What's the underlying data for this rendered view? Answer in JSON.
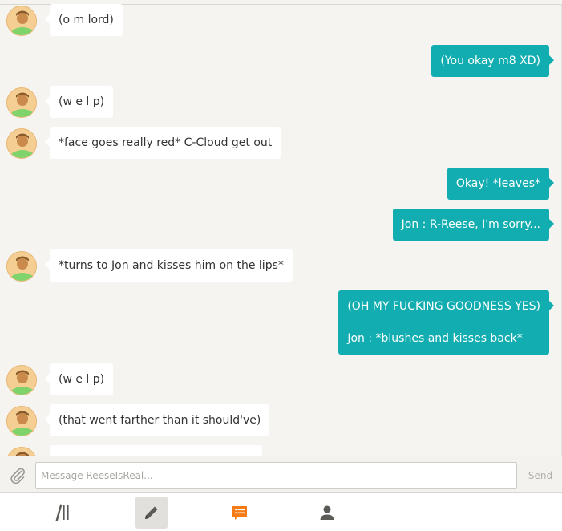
{
  "colors": {
    "outgoing": "#11adb0",
    "incoming": "#ffffff",
    "background": "#f5f4f1",
    "chat_tab": "#f47b16"
  },
  "messages": [
    {
      "side": "in",
      "text": "(o m lord)"
    },
    {
      "side": "out",
      "text": "(You okay m8 XD)"
    },
    {
      "side": "in",
      "text": "(w e l p)"
    },
    {
      "side": "in",
      "text": "*face goes really red* C-Cloud get out"
    },
    {
      "side": "out",
      "text": "Okay! *leaves*"
    },
    {
      "side": "out",
      "text": "Jon : R-Reese, I'm sorry..."
    },
    {
      "side": "in",
      "text": "*turns to Jon and kisses him on the lips*"
    },
    {
      "side": "out",
      "line1": "(OH MY FUCKING GOODNESS YES)",
      "line2": "Jon : *blushes and kisses back*"
    },
    {
      "side": "in",
      "text": "(w e l p)"
    },
    {
      "side": "in",
      "text": "(that went farther than it should've)"
    }
  ],
  "composer": {
    "attach_icon": "paperclip-icon",
    "placeholder": "Message ReeseIsReal...",
    "value": "",
    "send_label": "Send"
  },
  "tabbar": {
    "tabs": [
      {
        "icon": "library-icon",
        "active": false
      },
      {
        "icon": "pencil-icon",
        "active": true
      },
      {
        "icon": "chat-icon",
        "active": false
      },
      {
        "icon": "profile-icon",
        "active": false
      }
    ]
  }
}
